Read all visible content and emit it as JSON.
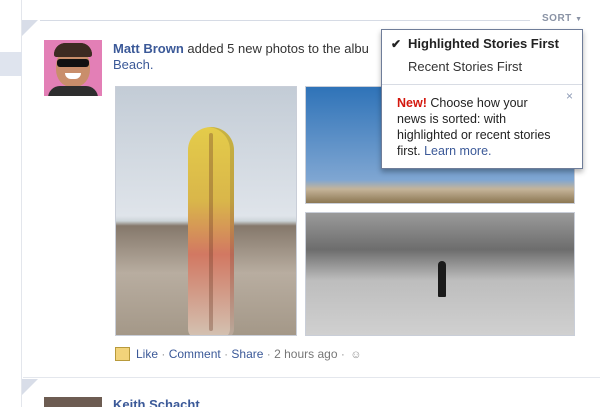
{
  "sort": {
    "label": "SORT",
    "caret": "▼",
    "options": [
      {
        "label": "Highlighted Stories First",
        "selected": true,
        "check": "✔"
      },
      {
        "label": "Recent Stories First",
        "selected": false
      }
    ],
    "notice": {
      "new_label": "New!",
      "text": "Choose how your news is sorted: with highlighted or recent stories first.",
      "learn_more": "Learn more.",
      "close": "×"
    }
  },
  "story": {
    "author": "Matt Brown",
    "action": "added 5 new photos to the albu",
    "album_link": "Beach.",
    "photos": [
      {
        "icon": "surfboard-photo"
      },
      {
        "icon": "dunes-color-photo"
      },
      {
        "icon": "dunes-bw-photo"
      }
    ],
    "actions": {
      "like": "Like",
      "separator": "·",
      "comment": "Comment",
      "share": "Share",
      "time": "2 hours ago",
      "privacy_icon": "friends-icon"
    }
  },
  "next_story": {
    "author": "Keith Schacht"
  }
}
